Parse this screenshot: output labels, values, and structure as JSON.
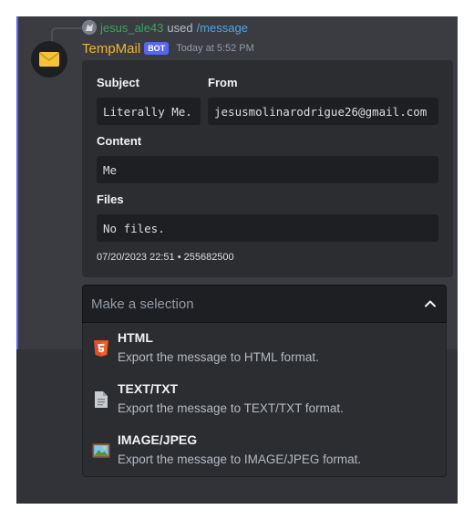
{
  "reply": {
    "username": "jesus_ale43",
    "used": "used",
    "command": "/message"
  },
  "message": {
    "author": "TempMail",
    "bot_tag": "BOT",
    "timestamp": "Today at 5:52 PM"
  },
  "embed": {
    "subject_label": "Subject",
    "subject_value": "Literally Me.",
    "from_label": "From",
    "from_value": "jesusmolinarodrigue26@gmail.com",
    "content_label": "Content",
    "content_value": "Me",
    "files_label": "Files",
    "files_value": "No files.",
    "footer": "07/20/2023 22:51 • 255682500"
  },
  "select_menu": {
    "placeholder": "Make a selection",
    "options": [
      {
        "label": "HTML",
        "description": "Export the message to HTML format.",
        "icon": "html5-icon"
      },
      {
        "label": "TEXT/TXT",
        "description": "Export the message to TEXT/TXT format.",
        "icon": "document-icon"
      },
      {
        "label": "IMAGE/JPEG",
        "description": "Export the message to IMAGE/JPEG format.",
        "icon": "picture-icon"
      }
    ]
  },
  "colors": {
    "background": "#313338",
    "highlight": "#3a3c42",
    "accent_bar": "#5865f2",
    "username": "#f0b232",
    "reply_user": "#3ba55c",
    "command": "#4ea7e6",
    "embed": "#2b2d31",
    "code_block": "#1e1f22"
  }
}
